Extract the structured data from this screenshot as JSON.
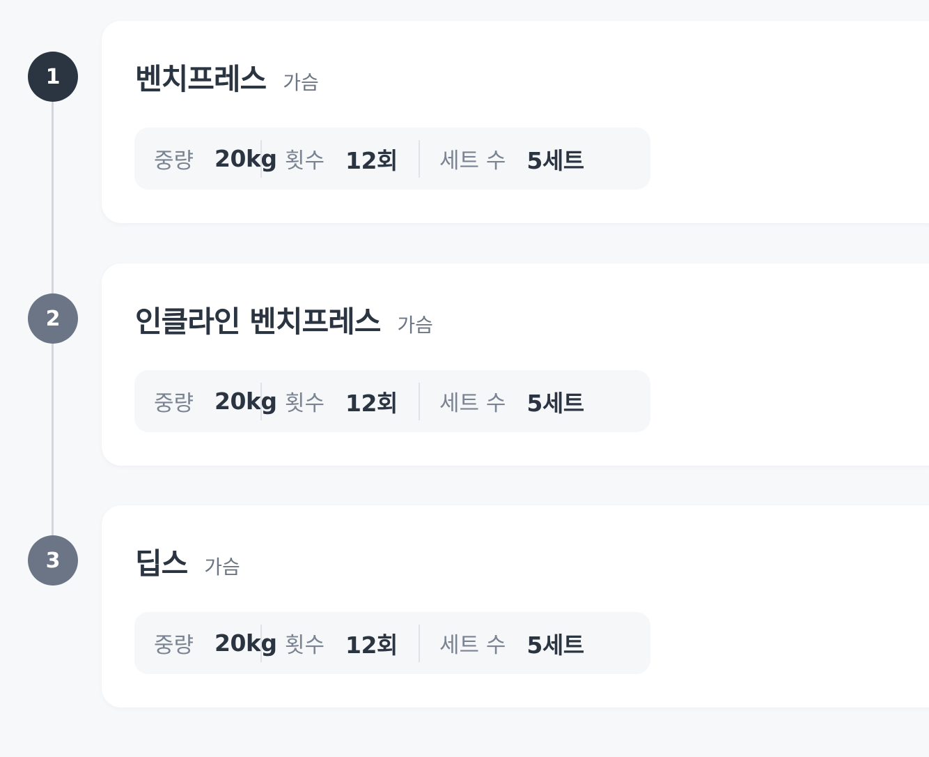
{
  "colors": {
    "step_active": "#2b3441",
    "step_inactive": "#6b7585",
    "rail": "#d3d6db"
  },
  "exercises": [
    {
      "step": "1",
      "name": "벤치프레스",
      "category": "가슴",
      "weight_label": "중량",
      "weight_value": "20kg",
      "reps_label": "횟수",
      "reps_value": "12회",
      "sets_label": "세트 수",
      "sets_value": "5세트"
    },
    {
      "step": "2",
      "name": "인클라인 벤치프레스",
      "category": "가슴",
      "weight_label": "중량",
      "weight_value": "20kg",
      "reps_label": "횟수",
      "reps_value": "12회",
      "sets_label": "세트 수",
      "sets_value": "5세트"
    },
    {
      "step": "3",
      "name": "딥스",
      "category": "가슴",
      "weight_label": "중량",
      "weight_value": "20kg",
      "reps_label": "횟수",
      "reps_value": "12회",
      "sets_label": "세트 수",
      "sets_value": "5세트"
    }
  ]
}
